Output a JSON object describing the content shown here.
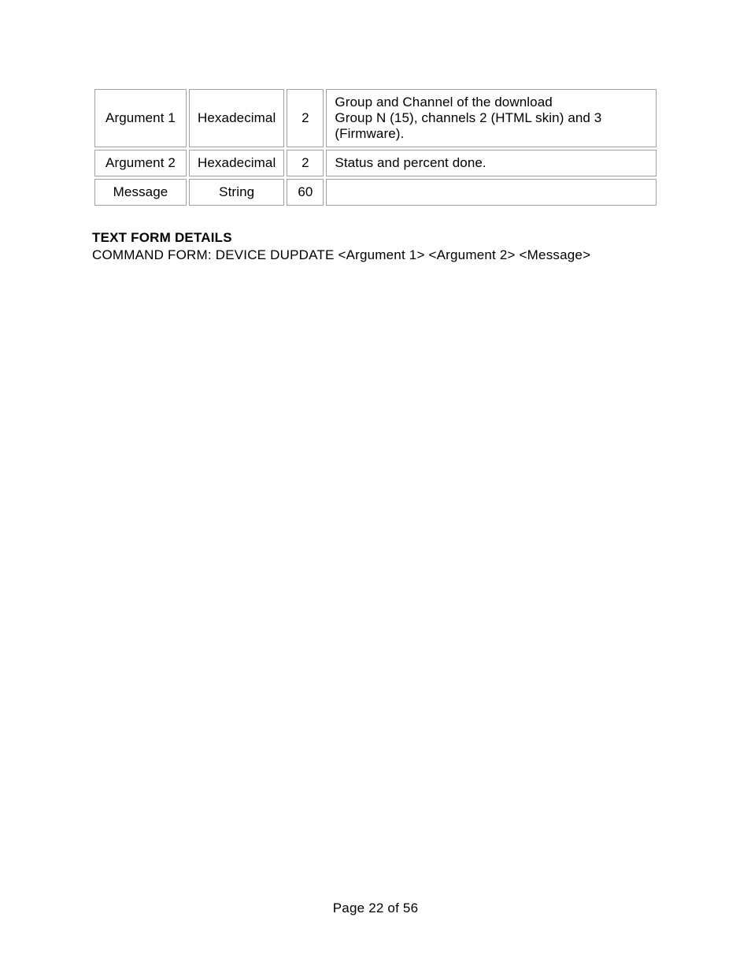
{
  "table": {
    "rows": [
      {
        "name": "Argument 1",
        "type": "Hexadecimal",
        "size": "2",
        "desc": "Group and Channel of the download\nGroup N (15), channels 2 (HTML skin) and 3 (Firmware)."
      },
      {
        "name": "Argument 2",
        "type": "Hexadecimal",
        "size": "2",
        "desc": "Status and percent done."
      },
      {
        "name": "Message",
        "type": "String",
        "size": "60",
        "desc": ""
      }
    ]
  },
  "section": {
    "title": "TEXT FORM DETAILS",
    "command_form": "COMMAND FORM: DEVICE DUPDATE <Argument 1> <Argument 2> <Message>"
  },
  "footer": {
    "page_text": "Page 22 of 56"
  }
}
